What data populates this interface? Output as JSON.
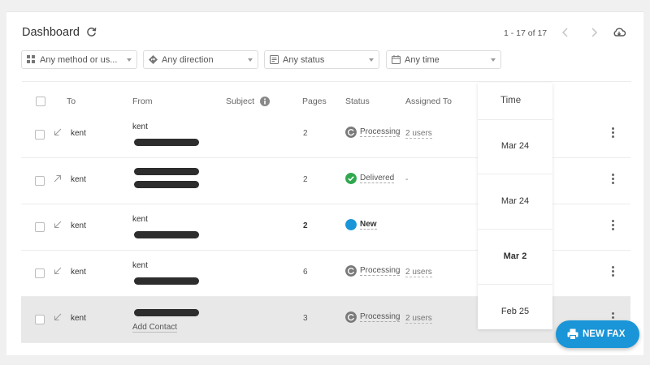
{
  "header": {
    "title": "Dashboard",
    "pagination": "1 - 17 of 17"
  },
  "filters": [
    {
      "label": "Any method or us...",
      "icon": "grid-icon"
    },
    {
      "label": "Any direction",
      "icon": "direction-icon"
    },
    {
      "label": "Any status",
      "icon": "status-icon"
    },
    {
      "label": "Any time",
      "icon": "calendar-icon"
    }
  ],
  "columns": {
    "to": "To",
    "from": "From",
    "subject": "Subject",
    "pages": "Pages",
    "status": "Status",
    "assigned": "Assigned To",
    "time": "Time"
  },
  "rows": [
    {
      "direction": "inbound",
      "to": "kent",
      "from": "kent",
      "pages": "2",
      "status": "Processing",
      "assigned": "2 users",
      "time": "Mar 24"
    },
    {
      "direction": "outbound",
      "to": "kent",
      "from": "",
      "pages": "2",
      "status": "Delivered",
      "assigned": "-",
      "time": "Mar 24"
    },
    {
      "direction": "inbound",
      "to": "kent",
      "from": "kent",
      "pages": "2",
      "status": "New",
      "assigned": "",
      "time": "Mar 2"
    },
    {
      "direction": "inbound",
      "to": "kent",
      "from": "kent",
      "pages": "6",
      "status": "Processing",
      "assigned": "2 users",
      "time": "Feb 25"
    },
    {
      "direction": "inbound",
      "to": "kent",
      "from": "",
      "add_contact": "Add Contact",
      "pages": "3",
      "status": "Processing",
      "assigned": "2 users",
      "time": ""
    }
  ],
  "fab": {
    "label": "NEW FAX"
  },
  "colors": {
    "accent": "#1a95d7",
    "delivered": "#2fa84f",
    "new": "#1a95d7",
    "processing": "#7a7a7a"
  }
}
